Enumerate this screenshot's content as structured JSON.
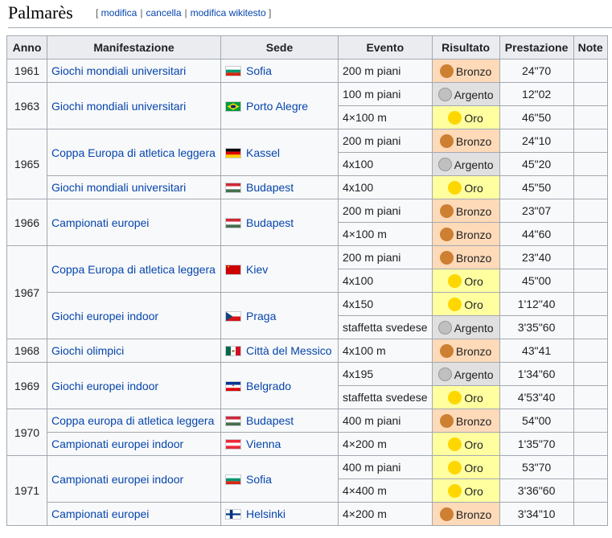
{
  "section": {
    "title": "Palmarès",
    "edit_links": [
      "modifica",
      "cancella",
      "modifica wikitesto"
    ]
  },
  "table": {
    "headers": [
      "Anno",
      "Manifestazione",
      "Sede",
      "Evento",
      "Risultato",
      "Prestazione",
      "Note"
    ],
    "rows": [
      {
        "anno": "1961",
        "manifestazione": "Giochi mondiali universitari",
        "sede": "Sofia",
        "flag": "bulgaria",
        "evento": "200 m piani",
        "risultato": "Bronzo",
        "prestazione": "24\"70"
      },
      {
        "anno": "1963",
        "manifestazione": "Giochi mondiali universitari",
        "sede": "Porto Alegre",
        "flag": "brazil",
        "evento": "100 m piani",
        "risultato": "Argento",
        "prestazione": "12\"02"
      },
      {
        "evento": "4×100 m",
        "risultato": "Oro",
        "prestazione": "46\"50"
      },
      {
        "anno": "1965",
        "manifestazione": "Coppa Europa di atletica leggera",
        "sede": "Kassel",
        "flag": "germany",
        "evento": "200 m piani",
        "risultato": "Bronzo",
        "prestazione": "24\"10"
      },
      {
        "evento": "4x100",
        "risultato": "Argento",
        "prestazione": "45\"20"
      },
      {
        "manifestazione": "Giochi mondiali universitari",
        "sede": "Budapest",
        "flag": "hungary",
        "evento": "4x100",
        "risultato": "Oro",
        "prestazione": "45\"50"
      },
      {
        "anno": "1966",
        "manifestazione": "Campionati europei",
        "sede": "Budapest",
        "flag": "hungary",
        "evento": "200 m piani",
        "risultato": "Bronzo",
        "prestazione": "23\"07"
      },
      {
        "evento": "4×100 m",
        "risultato": "Bronzo",
        "prestazione": "44\"60"
      },
      {
        "anno": "1967",
        "manifestazione": "Coppa Europa di atletica leggera",
        "sede": "Kiev",
        "flag": "ussr",
        "evento": "200 m piani",
        "risultato": "Bronzo",
        "prestazione": "23\"40"
      },
      {
        "evento": "4x100",
        "risultato": "Oro",
        "prestazione": "45\"00"
      },
      {
        "manifestazione": "Giochi europei indoor",
        "sede": "Praga",
        "flag": "czechoslovakia",
        "evento": "4x150",
        "risultato": "Oro",
        "prestazione": "1'12\"40"
      },
      {
        "evento": "staffetta svedese",
        "risultato": "Argento",
        "prestazione": "3'35\"60"
      },
      {
        "anno": "1968",
        "manifestazione": "Giochi olimpici",
        "sede": "Città del Messico",
        "flag": "mexico",
        "evento": "4x100 m",
        "risultato": "Bronzo",
        "prestazione": "43\"41"
      },
      {
        "anno": "1969",
        "manifestazione": "Giochi europei indoor",
        "sede": "Belgrado",
        "flag": "yugoslavia",
        "evento": "4x195",
        "risultato": "Argento",
        "prestazione": "1'34\"60"
      },
      {
        "evento": "staffetta svedese",
        "risultato": "Oro",
        "prestazione": "4'53\"40"
      },
      {
        "anno": "1970",
        "manifestazione": "Coppa europa di atletica leggera",
        "sede": "Budapest",
        "flag": "hungary",
        "evento": "400 m piani",
        "risultato": "Bronzo",
        "prestazione": "54\"00"
      },
      {
        "manifestazione": "Campionati europei indoor",
        "sede": "Vienna",
        "flag": "austria",
        "evento": "4×200 m",
        "risultato": "Oro",
        "prestazione": "1'35\"70"
      },
      {
        "anno": "1971",
        "manifestazione": "Campionati europei indoor",
        "sede": "Sofia",
        "flag": "bulgaria",
        "evento": "400 m piani",
        "risultato": "Oro",
        "prestazione": "53\"70"
      },
      {
        "evento": "4×400 m",
        "risultato": "Oro",
        "prestazione": "3'36\"60"
      },
      {
        "manifestazione": "Campionati europei",
        "sede": "Helsinki",
        "flag": "finland",
        "evento": "4×200 m",
        "risultato": "Bronzo",
        "prestazione": "3'34\"10"
      }
    ]
  },
  "colors": {
    "link": "#0645ad",
    "bronzo_bg": "#ffdab9",
    "argento_bg": "#e0e0e0",
    "oro_bg": "#ffffa0",
    "header_bg": "#eaecf0",
    "border": "#a2a9b1"
  }
}
